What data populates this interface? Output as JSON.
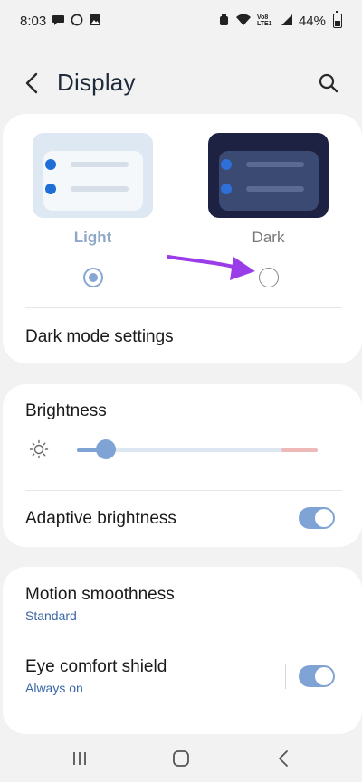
{
  "status_bar": {
    "time": "8:03",
    "network_label": "Vo8 LTE1",
    "battery": "44%"
  },
  "header": {
    "title": "Display"
  },
  "theme": {
    "light_label": "Light",
    "dark_label": "Dark",
    "selected": "Light"
  },
  "dark_mode_settings": {
    "label": "Dark mode settings"
  },
  "brightness": {
    "label": "Brightness",
    "level": 0.12
  },
  "adaptive_brightness": {
    "label": "Adaptive brightness",
    "enabled": true
  },
  "motion_smoothness": {
    "label": "Motion smoothness",
    "value": "Standard"
  },
  "eye_comfort": {
    "label": "Eye comfort shield",
    "value": "Always on",
    "enabled": true
  },
  "colors": {
    "accent": "#7fa3d4",
    "annotation_arrow": "#9a3de8"
  }
}
